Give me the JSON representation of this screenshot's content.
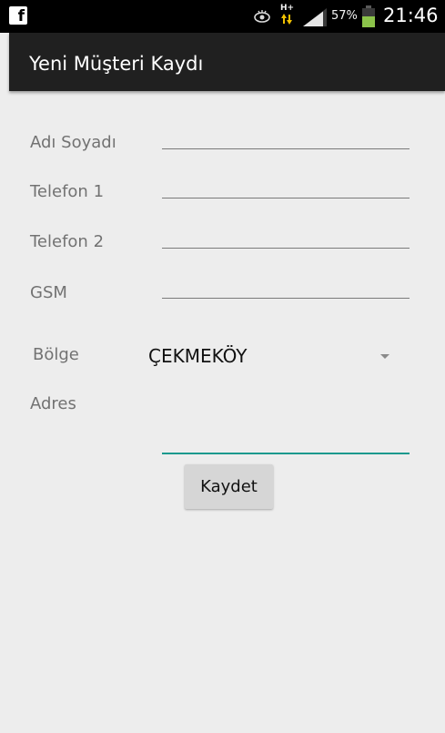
{
  "status_bar": {
    "battery_percent": "57%",
    "time": "21:46",
    "network_type": "H+",
    "app_icon": "facebook-icon",
    "icons": [
      "facebook-icon",
      "eye-icon",
      "network-icon",
      "signal-icon",
      "battery-icon"
    ]
  },
  "action_bar": {
    "title": "Yeni Müşteri Kaydı"
  },
  "form": {
    "name_label": "Adı Soyadı",
    "name_value": "",
    "phone1_label": "Telefon 1",
    "phone1_value": "",
    "phone2_label": "Telefon 2",
    "phone2_value": "",
    "gsm_label": "GSM",
    "gsm_value": "",
    "region_label": "Bölge",
    "region_value": "ÇEKMEKÖY",
    "address_label": "Adres",
    "address_value": "",
    "save_label": "Kaydet"
  },
  "colors": {
    "background": "#ededed",
    "action_bar": "#202020",
    "status_bar": "#000000",
    "accent": "#1a998e",
    "battery": "#8bc34a",
    "label_text": "#727272",
    "button": "#d6d6d6"
  }
}
